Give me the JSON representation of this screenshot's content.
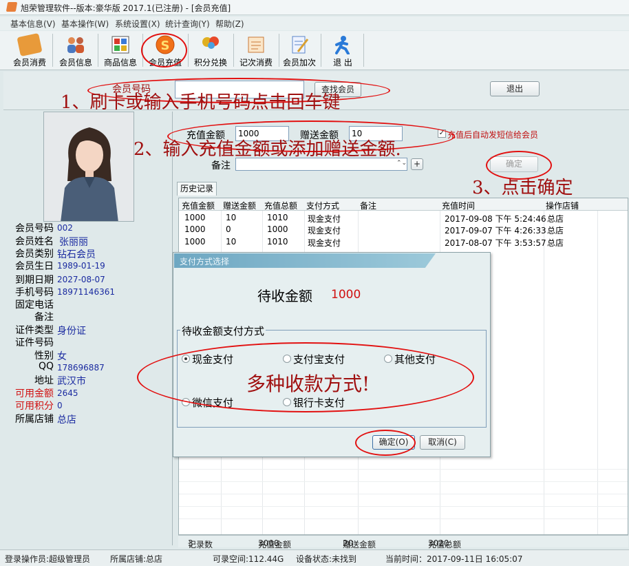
{
  "window": {
    "title": "旭荣管理软件--版本:豪华版 2017.1(已注册) - [会员充值]"
  },
  "menu": [
    "基本信息(V)",
    "基本操作(W)",
    "系统设置(X)",
    "统计查询(Y)",
    "帮助(Z)"
  ],
  "toolbar": [
    {
      "label": "会员消费",
      "icon": "card-icon",
      "color": "#e89a3a"
    },
    {
      "label": "会员信息",
      "icon": "users-icon",
      "color": "#d06a3a"
    },
    {
      "label": "商品信息",
      "icon": "grid-icon",
      "color": "#4a79c8"
    },
    {
      "label": "会员充值",
      "icon": "dollar-coin-icon",
      "color": "#e8621a"
    },
    {
      "label": "积分兑换",
      "icon": "balloons-icon",
      "color": "#e0b020"
    },
    {
      "label": "记次消费",
      "icon": "notebook-icon",
      "color": "#d87a3a"
    },
    {
      "label": "会员加次",
      "icon": "edit-doc-icon",
      "color": "#5b84c8"
    },
    {
      "label": "退  出",
      "icon": "running-man-icon",
      "color": "#2a7ad8"
    }
  ],
  "search": {
    "label": "会员号码",
    "value": "",
    "button": "查找会员",
    "exit_button": "退出"
  },
  "annotations": {
    "step1": "1、刷卡或输入手机号码点击回车键",
    "step2": "2、输入充值金额或添加赠送金额.",
    "step3": "3、点击确定",
    "multi": "多种收款方式!"
  },
  "member": {
    "fields": [
      {
        "k": "会员号码",
        "v": "002"
      },
      {
        "k": "会员姓名",
        "v": "张丽丽"
      },
      {
        "k": "会员类别",
        "v": "钻石会员"
      },
      {
        "k": "会员生日",
        "v": "1989-01-19"
      },
      {
        "k": "到期日期",
        "v": "2027-08-07"
      },
      {
        "k": "手机号码",
        "v": "18971146361"
      },
      {
        "k": "固定电话",
        "v": ""
      },
      {
        "k": "备注",
        "v": ""
      },
      {
        "k": "证件类型",
        "v": "身份证"
      },
      {
        "k": "证件号码",
        "v": ""
      },
      {
        "k": "性别",
        "v": "女"
      },
      {
        "k": "QQ",
        "v": "178696887"
      },
      {
        "k": "地址",
        "v": "武汉市"
      },
      {
        "k": "可用金额",
        "v": "2645"
      },
      {
        "k": "可用积分",
        "v": "0"
      },
      {
        "k": "所属店铺",
        "v": "总店"
      }
    ]
  },
  "recharge": {
    "amount_label": "充值金额",
    "amount_value": "1000",
    "gift_label": "赠送金额",
    "gift_value": "10",
    "sms_label": "充值后自动发短信给会员",
    "sms_checked": true,
    "note_label": "备注",
    "note_value": "",
    "add_button": "+",
    "confirm_button": "确定"
  },
  "history": {
    "tab": "历史记录",
    "columns": [
      "充值金额",
      "赠送金额",
      "充值总额",
      "支付方式",
      "备注",
      "充值时间",
      "操作店铺"
    ],
    "rows": [
      [
        "1000",
        "10",
        "1010",
        "现金支付",
        "",
        "2017-09-08 下午 5:24:46",
        "总店"
      ],
      [
        "1000",
        "0",
        "1000",
        "现金支付",
        "",
        "2017-09-07 下午 4:26:33",
        "总店"
      ],
      [
        "1000",
        "10",
        "1010",
        "现金支付",
        "",
        "2017-08-07 下午 3:53:57",
        "总店"
      ]
    ],
    "footer": {
      "count_label": "记录数",
      "count": "3",
      "recharge_label": "充值金额",
      "recharge": "3000",
      "gift_label": "赠送金额",
      "gift": "20",
      "total_label": "充值总额",
      "total": "3020"
    }
  },
  "payment_dialog": {
    "title": "支付方式选择",
    "due_label": "待收金额",
    "due_value": "1000",
    "group_label": "待收金额支付方式",
    "options": [
      "现金支付",
      "支付宝支付",
      "其他支付",
      "微信支付",
      "银行卡支付"
    ],
    "selected": "现金支付",
    "ok_button": "确定(O)",
    "cancel_button": "取消(C)"
  },
  "status": {
    "operator": "登录操作员:超级管理员",
    "shop": "所属店铺:总店",
    "space": "可录空间:112.44G",
    "device": "设备状态:未找到",
    "time": "当前时间：2017-09-11日 16:05:07"
  },
  "colors": {
    "annotation_ring": "#e21010",
    "annotation_text": "#a01010",
    "value_blue": "#1a2aa0",
    "money_red": "#d01010"
  }
}
